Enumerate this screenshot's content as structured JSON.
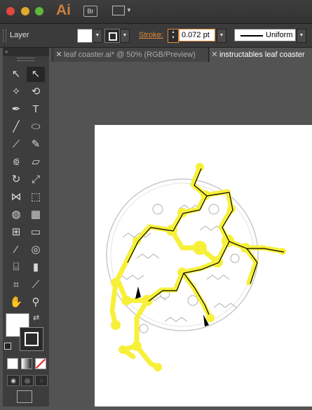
{
  "app": {
    "logo_text": "Ai",
    "bridge_label": "Br"
  },
  "control_bar": {
    "selection_label": "Layer",
    "stroke_label": "Stroke:",
    "stroke_weight": "0.072 pt",
    "profile_label": "Uniform"
  },
  "tabs": [
    {
      "label": "leaf coaster.ai* @ 50% (RGB/Preview)",
      "active": false
    },
    {
      "label": "instructables leaf coaster",
      "active": true
    }
  ],
  "tools": [
    {
      "name": "selection-tool",
      "icon": "arrow-pointer-icon",
      "glyph": "↖",
      "active": false
    },
    {
      "name": "direct-selection-tool",
      "icon": "direct-select-icon",
      "glyph": "↖",
      "active": true
    },
    {
      "name": "magic-wand-tool",
      "icon": "magic-wand-icon",
      "glyph": "✧",
      "active": false
    },
    {
      "name": "lasso-tool",
      "icon": "lasso-icon",
      "glyph": "⟲",
      "active": false
    },
    {
      "name": "pen-tool",
      "icon": "pen-icon",
      "glyph": "✒",
      "active": false
    },
    {
      "name": "type-tool",
      "icon": "type-icon",
      "glyph": "T",
      "active": false
    },
    {
      "name": "line-tool",
      "icon": "line-segment-icon",
      "glyph": "╱",
      "active": false
    },
    {
      "name": "ellipse-tool",
      "icon": "ellipse-icon",
      "glyph": "⬭",
      "active": false
    },
    {
      "name": "paintbrush-tool",
      "icon": "paintbrush-icon",
      "glyph": "⟋",
      "active": false
    },
    {
      "name": "pencil-tool",
      "icon": "pencil-icon",
      "glyph": "✎",
      "active": false
    },
    {
      "name": "blob-brush-tool",
      "icon": "blob-brush-icon",
      "glyph": "⟃",
      "active": false
    },
    {
      "name": "eraser-tool",
      "icon": "eraser-icon",
      "glyph": "▱",
      "active": false
    },
    {
      "name": "rotate-tool",
      "icon": "rotate-icon",
      "glyph": "↻",
      "active": false
    },
    {
      "name": "scale-tool",
      "icon": "scale-icon",
      "glyph": "⤢",
      "active": false
    },
    {
      "name": "width-tool",
      "icon": "width-icon",
      "glyph": "⋈",
      "active": false
    },
    {
      "name": "free-transform-tool",
      "icon": "free-transform-icon",
      "glyph": "⬚",
      "active": false
    },
    {
      "name": "shape-builder-tool",
      "icon": "shape-builder-icon",
      "glyph": "◍",
      "active": false
    },
    {
      "name": "perspective-grid-tool",
      "icon": "perspective-grid-icon",
      "glyph": "▦",
      "active": false
    },
    {
      "name": "mesh-tool",
      "icon": "mesh-icon",
      "glyph": "⊞",
      "active": false
    },
    {
      "name": "gradient-tool",
      "icon": "gradient-icon",
      "glyph": "▭",
      "active": false
    },
    {
      "name": "eyedropper-tool",
      "icon": "eyedropper-icon",
      "glyph": "⁄",
      "active": false
    },
    {
      "name": "blend-tool",
      "icon": "blend-icon",
      "glyph": "◎",
      "active": false
    },
    {
      "name": "symbol-sprayer-tool",
      "icon": "symbol-sprayer-icon",
      "glyph": "⌸",
      "active": false
    },
    {
      "name": "column-graph-tool",
      "icon": "column-graph-icon",
      "glyph": "▮",
      "active": false
    },
    {
      "name": "artboard-tool",
      "icon": "artboard-icon",
      "glyph": "⌗",
      "active": false
    },
    {
      "name": "slice-tool",
      "icon": "slice-icon",
      "glyph": "⟋",
      "active": false
    },
    {
      "name": "hand-tool",
      "icon": "hand-icon",
      "glyph": "✋",
      "active": false
    },
    {
      "name": "zoom-tool",
      "icon": "zoom-icon",
      "glyph": "⚲",
      "active": false
    }
  ],
  "colors": {
    "highlight_yellow": "#f7f03a",
    "path_gray": "#b0b0b0",
    "stroke_accent": "#e08a3a"
  }
}
